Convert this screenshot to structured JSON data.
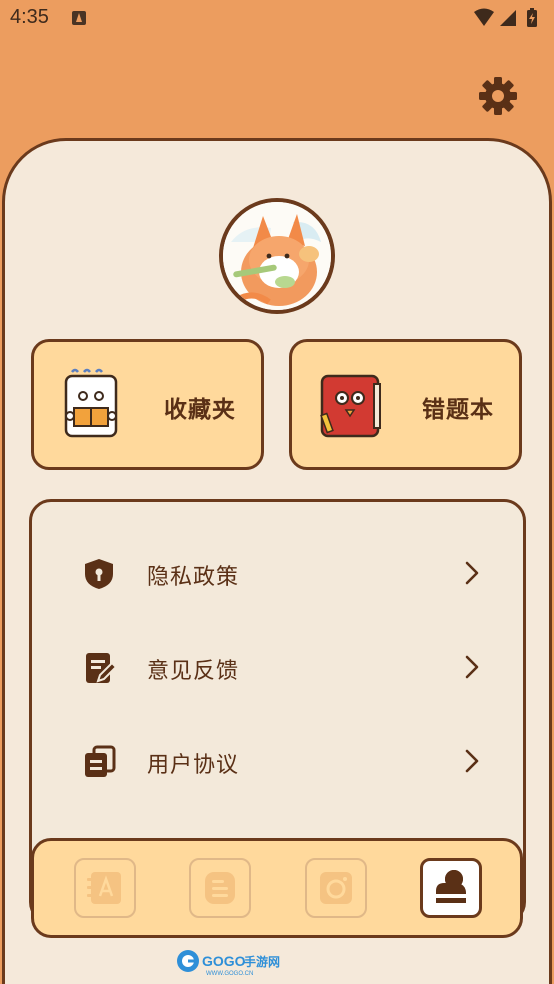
{
  "status_bar": {
    "time": "4:35",
    "icons": [
      "notification-a-icon",
      "wifi-icon",
      "signal-icon",
      "battery-icon"
    ]
  },
  "header": {
    "settings_icon": "gear-icon"
  },
  "profile": {
    "avatar_icon": "fox-avatar"
  },
  "tiles": [
    {
      "label": "收藏夹",
      "icon": "notebook-character-icon"
    },
    {
      "label": "错题本",
      "icon": "red-book-character-icon"
    }
  ],
  "menu": {
    "items": [
      {
        "label": "隐私政策",
        "icon": "shield-icon"
      },
      {
        "label": "意见反馈",
        "icon": "feedback-edit-icon"
      },
      {
        "label": "用户协议",
        "icon": "documents-icon"
      }
    ]
  },
  "bottom_nav": {
    "items": [
      {
        "name": "vocabulary-book",
        "icon": "book-a-icon",
        "active": false
      },
      {
        "name": "notes",
        "icon": "list-doc-icon",
        "active": false
      },
      {
        "name": "camera",
        "icon": "camera-icon",
        "active": false
      },
      {
        "name": "profile",
        "icon": "person-icon",
        "active": true
      }
    ]
  },
  "watermark": {
    "text": "GOGO手游网",
    "subtext": "WWW.GOGO.CN"
  },
  "colors": {
    "background": "#EC9D5F",
    "card": "#F5E9DA",
    "tile": "#FFD99C",
    "outline": "#6B3A1C",
    "text": "#5A3016"
  }
}
